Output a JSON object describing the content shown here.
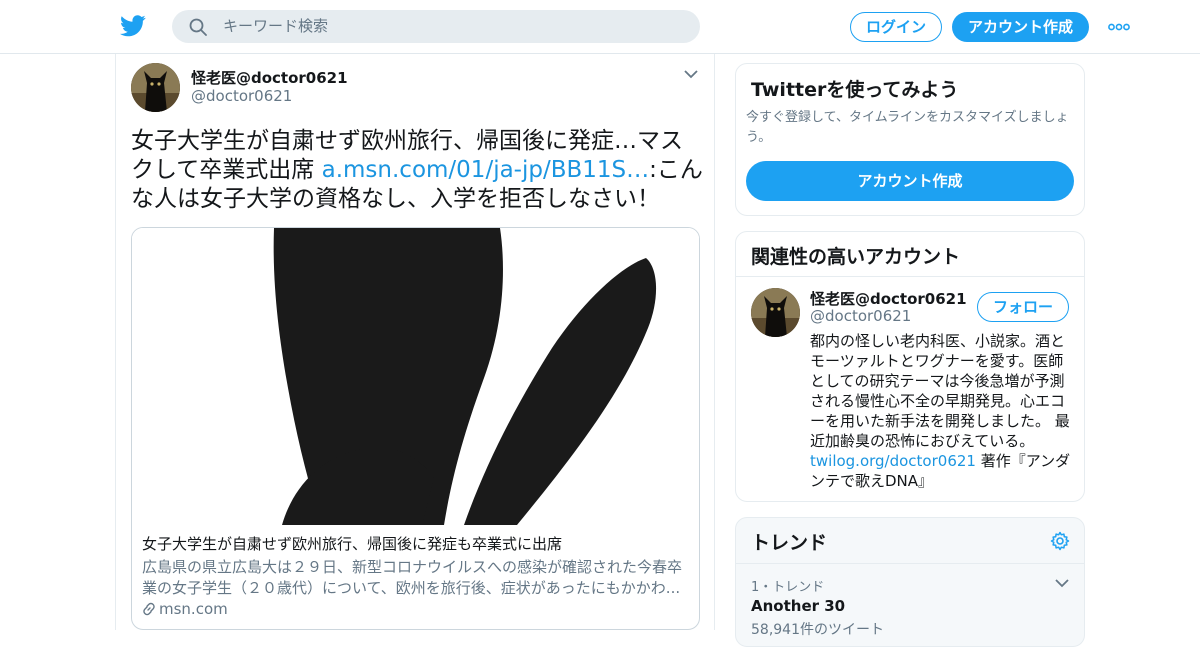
{
  "header": {
    "search_placeholder": "キーワード検索",
    "login_label": "ログイン",
    "signup_label": "アカウント作成"
  },
  "tweet": {
    "author_name": "怪老医@doctor0621",
    "author_handle": "@doctor0621",
    "text_before_link": "女子大学生が自粛せず欧州旅行、帰国後に発症…マスクして卒業式出席 ",
    "link_text": "a.msn.com/01/ja-jp/BB11S…",
    "text_after_link": ":こんな人は女子大学の資格なし、入学を拒否しなさい！",
    "card": {
      "title": "女子大学生が自粛せず欧州旅行、帰国後に発症も卒業式に出席",
      "description": "広島県の県立広島大は２９日、新型コロナウイルスへの感染が確認された今春卒業の女子学生（２０歳代）について、欧州を旅行後、症状があったにもかかわ...",
      "domain": "msn.com"
    }
  },
  "signup_panel": {
    "title": "Twitterを使ってみよう",
    "subtitle": "今すぐ登録して、タイムラインをカスタマイズしましょう。",
    "button_label": "アカウント作成"
  },
  "related_panel": {
    "title": "関連性の高いアカウント",
    "account": {
      "name": "怪老医@doctor0621",
      "handle": "@doctor0621",
      "follow_label": "フォロー",
      "bio_text": "都内の怪しい老内科医、小説家。酒とモーツァルトとワグナーを愛す。医師としての研究テーマは今後急増が予測される慢性心不全の早期発見。心エコーを用いた新手法を開発しました。 最近加齢臭の恐怖におびえている。",
      "bio_link": "twilog.org/doctor0621",
      "bio_tail": " 著作『アンダンテで歌えDNA』"
    }
  },
  "trends_panel": {
    "title": "トレンド",
    "items": [
      {
        "meta": "1・トレンド",
        "topic": "Another 30",
        "count": "58,941件のツイート"
      }
    ]
  },
  "colors": {
    "accent": "#1da1f2",
    "link": "#1b95e0",
    "muted": "#657786",
    "border": "#e6ecf0"
  }
}
